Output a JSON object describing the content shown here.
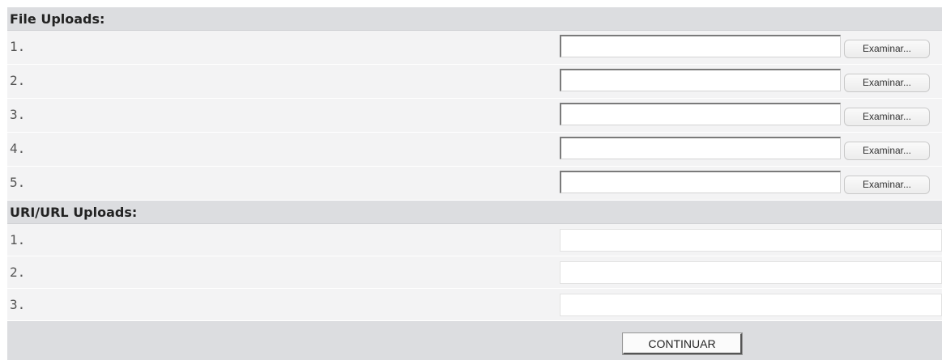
{
  "file_uploads": {
    "header": "File Uploads:",
    "rows": [
      {
        "number": "1.",
        "value": "",
        "browse_label": "Examinar..."
      },
      {
        "number": "2.",
        "value": "",
        "browse_label": "Examinar..."
      },
      {
        "number": "3.",
        "value": "",
        "browse_label": "Examinar..."
      },
      {
        "number": "4.",
        "value": "",
        "browse_label": "Examinar..."
      },
      {
        "number": "5.",
        "value": "",
        "browse_label": "Examinar..."
      }
    ]
  },
  "url_uploads": {
    "header": "URI/URL Uploads:",
    "rows": [
      {
        "number": "1.",
        "value": ""
      },
      {
        "number": "2.",
        "value": ""
      },
      {
        "number": "3.",
        "value": ""
      }
    ]
  },
  "footer": {
    "continue_label": "CONTINUAR"
  }
}
